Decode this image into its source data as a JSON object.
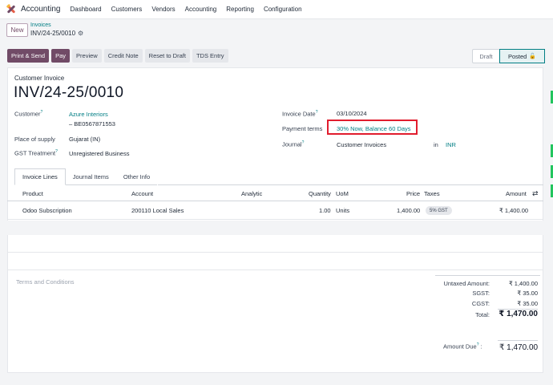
{
  "nav": {
    "app_name": "Accounting",
    "items": [
      "Dashboard",
      "Customers",
      "Vendors",
      "Accounting",
      "Reporting",
      "Configuration"
    ]
  },
  "breadcrumb": {
    "new_label": "New",
    "parent": "Invoices",
    "current": "INV/24-25/0010",
    "gear_icon": "⚙"
  },
  "actions": [
    "Print & Send",
    "Pay",
    "Preview",
    "Credit Note",
    "Reset to Draft",
    "TDS Entry"
  ],
  "status": {
    "draft": "Draft",
    "posted": "Posted",
    "lock_icon": "🔓"
  },
  "form": {
    "kind": "Customer Invoice",
    "number": "INV/24-25/0010",
    "customer_label": "Customer",
    "customer_name": "Azure Interiors",
    "customer_vat": "– BE0567871553",
    "supply_label": "Place of supply",
    "supply_value": "Gujarat (IN)",
    "gst_label": "GST Treatment",
    "gst_value": "Unregistered Business",
    "date_label": "Invoice Date",
    "date_value": "03/10/2024",
    "terms_label": "Payment terms",
    "terms_value": "30% Now, Balance 60 Days",
    "journal_label": "Journal",
    "journal_value": "Customer Invoices",
    "in_label": "in",
    "currency": "INR",
    "help_mark": "?"
  },
  "tabs": [
    "Invoice Lines",
    "Journal Items",
    "Other Info"
  ],
  "table": {
    "columns": [
      "Product",
      "Account",
      "Analytic",
      "Quantity",
      "UoM",
      "Price",
      "Taxes",
      "Amount"
    ],
    "settings_icon": "⇄",
    "rows": [
      {
        "product": "Odoo Subscription",
        "account": "200110 Local Sales",
        "analytic": "",
        "quantity": "1.00",
        "uom": "Units",
        "price": "1,400.00",
        "taxes": "5% GST",
        "amount": "₹ 1,400.00"
      }
    ]
  },
  "terms_placeholder": "Terms and Conditions",
  "totals": {
    "untaxed_label": "Untaxed Amount:",
    "untaxed_value": "₹ 1,400.00",
    "sgst_label": "SGST:",
    "sgst_value": "₹ 35.00",
    "cgst_label": "CGST:",
    "cgst_value": "₹ 35.00",
    "total_label": "Total:",
    "total_value": "₹ 1,470.00",
    "due_label": "Amount Due",
    "due_value": "₹ 1,470.00"
  },
  "colors": {
    "brand": "#714b67",
    "link": "#017e84",
    "highlight": "#e11d2e"
  }
}
